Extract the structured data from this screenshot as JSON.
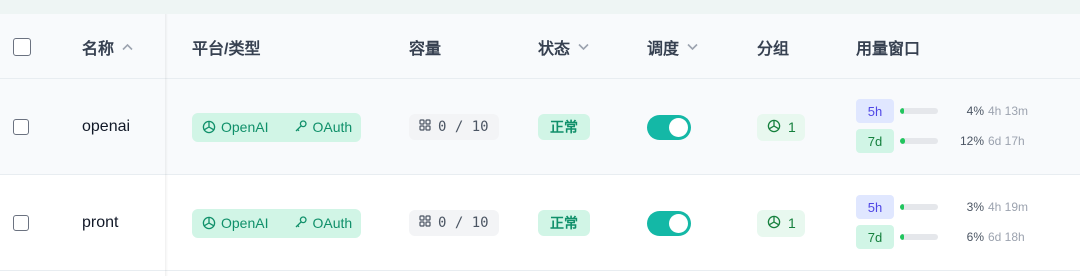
{
  "columns": {
    "name": "名称",
    "platform_type": "平台/类型",
    "capacity": "容量",
    "status": "状态",
    "scheduling": "调度",
    "group": "分组",
    "usage_window": "用量窗口"
  },
  "icons": {
    "sort": "chevron-up-icon",
    "filter": "chevron-down-icon",
    "platform": "openai-icon",
    "auth": "key-icon",
    "capacity": "grid-icon"
  },
  "colors": {
    "accent": "#14b8a6",
    "success_bg": "#d1f5e6",
    "success_fg": "#10906a",
    "bar_fill": "#22c55e"
  },
  "rows": [
    {
      "name": "openai",
      "platform": "OpenAI",
      "auth": "OAuth",
      "capacity": "0 / 10",
      "status": "正常",
      "scheduling_enabled": true,
      "group_count": "1",
      "usage": [
        {
          "window": "5h",
          "percent_text": "4%",
          "percent": 4,
          "reset": "4h 13m"
        },
        {
          "window": "7d",
          "percent_text": "12%",
          "percent": 12,
          "reset": "6d 17h"
        }
      ]
    },
    {
      "name": "pront",
      "platform": "OpenAI",
      "auth": "OAuth",
      "capacity": "0 / 10",
      "status": "正常",
      "scheduling_enabled": true,
      "group_count": "1",
      "usage": [
        {
          "window": "5h",
          "percent_text": "3%",
          "percent": 3,
          "reset": "4h 19m"
        },
        {
          "window": "7d",
          "percent_text": "6%",
          "percent": 6,
          "reset": "6d 18h"
        }
      ]
    }
  ]
}
